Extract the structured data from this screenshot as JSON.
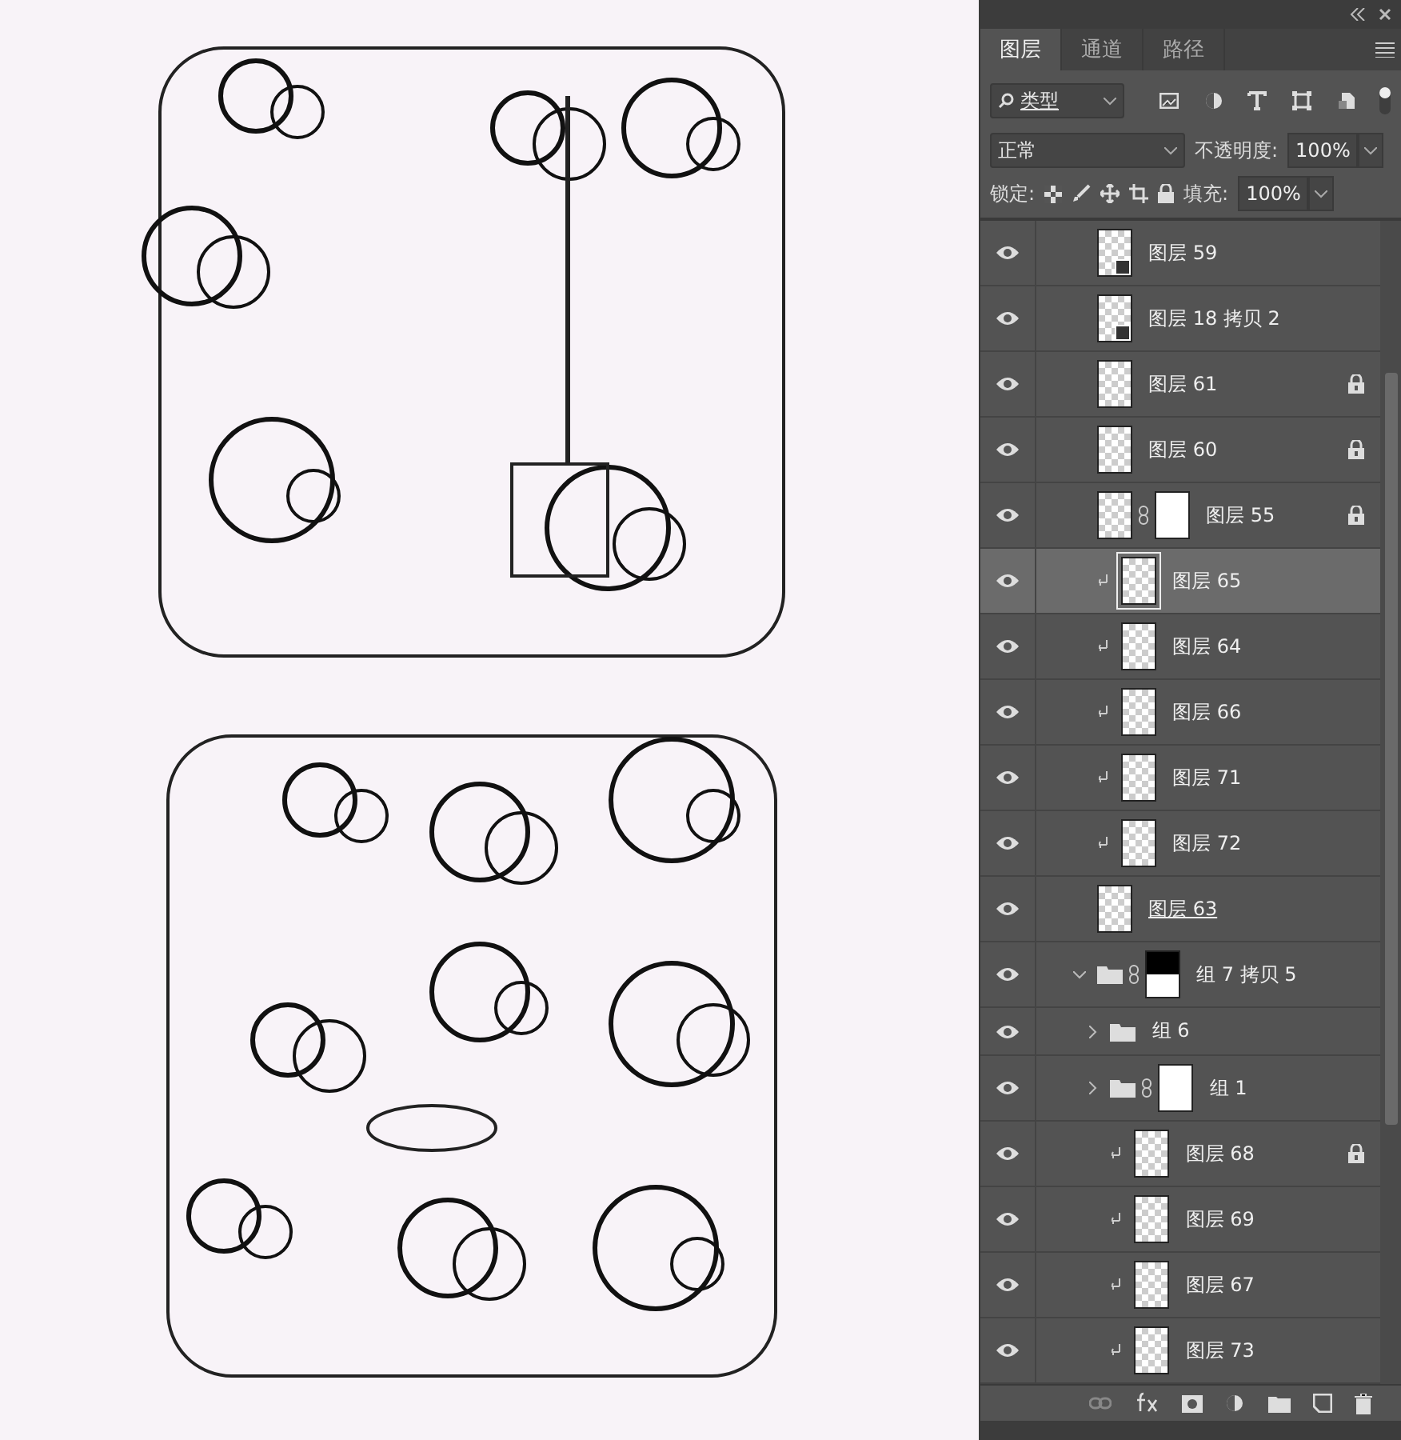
{
  "panel": {
    "tabs": [
      {
        "label": "图层",
        "selected": true
      },
      {
        "label": "通道",
        "selected": false
      },
      {
        "label": "路径",
        "selected": false
      }
    ],
    "filter": {
      "value": "类型"
    },
    "blend_mode": {
      "value": "正常"
    },
    "opacity": {
      "label": "不透明度:",
      "value": "100%"
    },
    "lock": {
      "label": "锁定:"
    },
    "fill": {
      "label": "填充:",
      "value": "100%"
    }
  },
  "layers": [
    {
      "name": "图层 59",
      "kind": "smart",
      "clipped": false,
      "locked": false,
      "mask": false,
      "selected": false,
      "visible": true,
      "underlined": false
    },
    {
      "name": "图层 18 拷贝 2",
      "kind": "smart",
      "clipped": false,
      "locked": false,
      "mask": false,
      "selected": false,
      "visible": true,
      "underlined": false
    },
    {
      "name": "图层 61",
      "kind": "layer",
      "clipped": false,
      "locked": true,
      "mask": false,
      "selected": false,
      "visible": true,
      "underlined": false
    },
    {
      "name": "图层 60",
      "kind": "layer",
      "clipped": false,
      "locked": true,
      "mask": false,
      "selected": false,
      "visible": true,
      "underlined": false
    },
    {
      "name": "图层 55",
      "kind": "layer",
      "clipped": false,
      "locked": true,
      "mask": true,
      "selected": false,
      "visible": true,
      "underlined": false
    },
    {
      "name": "图层 65",
      "kind": "layer",
      "clipped": true,
      "locked": false,
      "mask": false,
      "selected": true,
      "visible": true,
      "underlined": false
    },
    {
      "name": "图层 64",
      "kind": "layer",
      "clipped": true,
      "locked": false,
      "mask": false,
      "selected": false,
      "visible": true,
      "underlined": false
    },
    {
      "name": "图层 66",
      "kind": "layer",
      "clipped": true,
      "locked": false,
      "mask": false,
      "selected": false,
      "visible": true,
      "underlined": false
    },
    {
      "name": "图层 71",
      "kind": "layer",
      "clipped": true,
      "locked": false,
      "mask": false,
      "selected": false,
      "visible": true,
      "underlined": false
    },
    {
      "name": "图层 72",
      "kind": "layer",
      "clipped": true,
      "locked": false,
      "mask": false,
      "selected": false,
      "visible": true,
      "underlined": false
    },
    {
      "name": "图层 63",
      "kind": "layer",
      "clipped": false,
      "locked": false,
      "mask": false,
      "selected": false,
      "visible": true,
      "underlined": true
    },
    {
      "name": "组 7 拷贝 5",
      "kind": "group",
      "clipped": false,
      "locked": false,
      "mask": true,
      "selected": false,
      "visible": true,
      "underlined": false,
      "expanded": true,
      "children": [
        {
          "name": "组 6",
          "kind": "group",
          "clipped": false,
          "locked": false,
          "mask": false,
          "selected": false,
          "visible": true,
          "underlined": false,
          "expanded": false
        },
        {
          "name": "组 1",
          "kind": "group",
          "clipped": false,
          "locked": false,
          "mask": true,
          "selected": false,
          "visible": true,
          "underlined": false,
          "expanded": false
        },
        {
          "name": "图层 68",
          "kind": "layer",
          "clipped": true,
          "locked": true,
          "mask": false,
          "selected": false,
          "visible": true,
          "underlined": false
        },
        {
          "name": "图层 69",
          "kind": "layer",
          "clipped": true,
          "locked": false,
          "mask": false,
          "selected": false,
          "visible": true,
          "underlined": false
        },
        {
          "name": "图层 67",
          "kind": "layer",
          "clipped": true,
          "locked": false,
          "mask": false,
          "selected": false,
          "visible": true,
          "underlined": false
        },
        {
          "name": "图层 73",
          "kind": "layer",
          "clipped": true,
          "locked": false,
          "mask": false,
          "selected": false,
          "visible": true,
          "underlined": false
        }
      ]
    }
  ]
}
